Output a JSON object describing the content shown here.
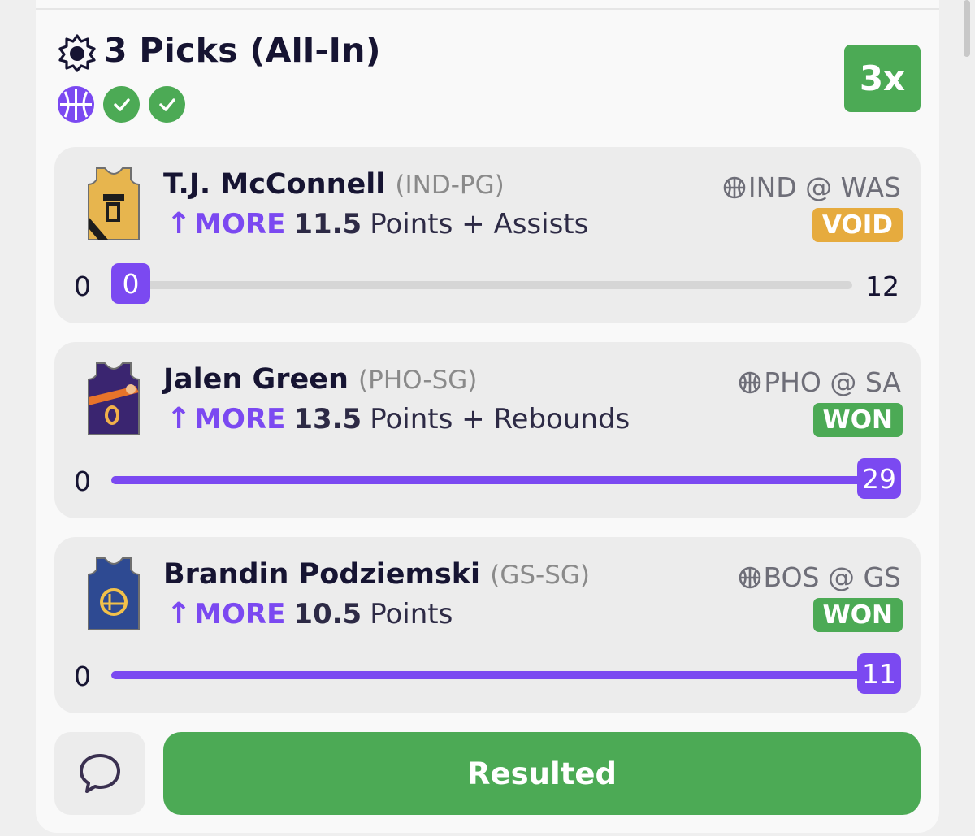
{
  "header": {
    "title": "3 Picks (All-In)",
    "multiplier": "3x",
    "header_icon": "gear-sun-icon",
    "status_icons": [
      "basketball-icon",
      "check-icon",
      "check-icon"
    ]
  },
  "colors": {
    "accent": "#7b49f1",
    "won": "#4caa55",
    "void": "#e6ab3e"
  },
  "picks": [
    {
      "player": "T.J. McConnell",
      "position": "(IND-PG)",
      "direction": "MORE",
      "line": "11.5",
      "stat": "Points + Assists",
      "game": "IND @ WAS",
      "result": "VOID",
      "min": "0",
      "current": "0",
      "target": "12",
      "progress": 0
    },
    {
      "player": "Jalen Green",
      "position": "(PHO-SG)",
      "direction": "MORE",
      "line": "13.5",
      "stat": "Points + Rebounds",
      "game": "PHO @ SA",
      "result": "WON",
      "min": "0",
      "current": "29",
      "progress": 1
    },
    {
      "player": "Brandin Podziemski",
      "position": "(GS-SG)",
      "direction": "MORE",
      "line": "10.5",
      "stat": "Points",
      "game": "BOS @ GS",
      "result": "WON",
      "min": "0",
      "current": "11",
      "progress": 1
    }
  ],
  "footer": {
    "chat_icon": "chat-bubble-icon",
    "resulted_label": "Resulted"
  }
}
